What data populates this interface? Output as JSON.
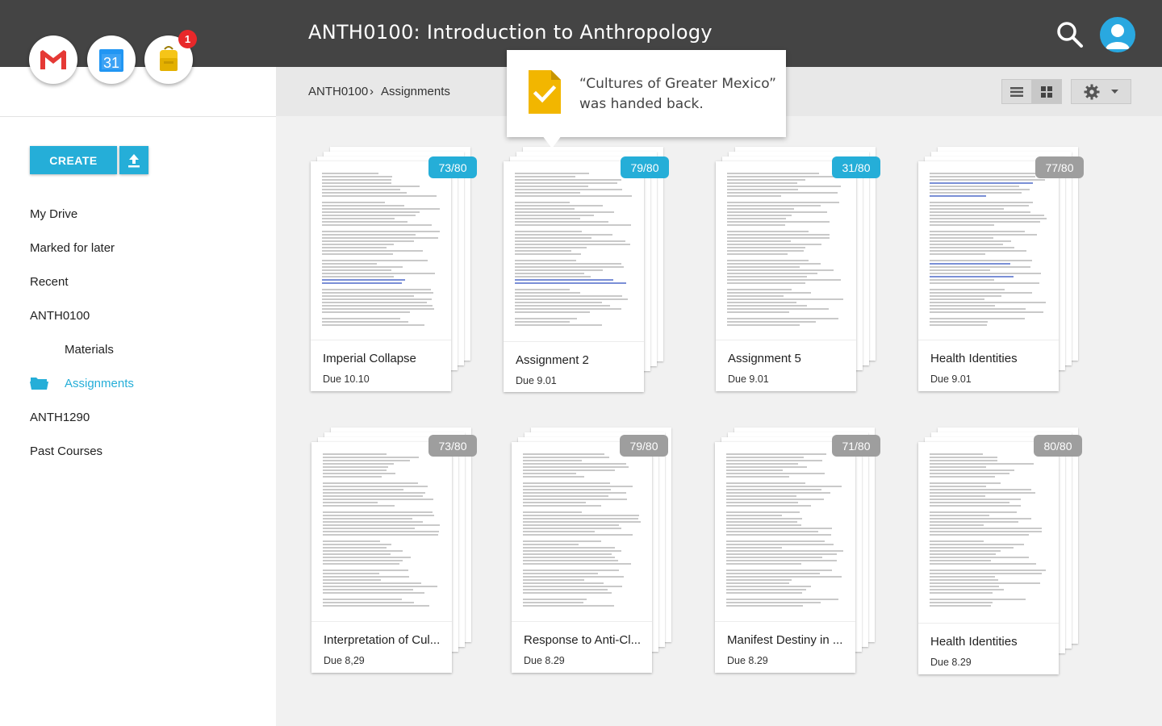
{
  "header": {
    "title": "ANTH0100: Introduction to Anthropology"
  },
  "apps": {
    "notification_count": "1",
    "calendar_day": "31"
  },
  "sidebar": {
    "create_label": "CREATE",
    "items": [
      {
        "label": "My Drive"
      },
      {
        "label": "Marked for later"
      },
      {
        "label": "Recent"
      },
      {
        "label": "ANTH0100"
      },
      {
        "label": "Materials"
      },
      {
        "label": "Assignments"
      },
      {
        "label": "ANTH1290"
      },
      {
        "label": "Past Courses"
      }
    ]
  },
  "breadcrumb": {
    "parent": "ANTH0100",
    "separator": "›",
    "current": "Assignments"
  },
  "tooltip": {
    "line1": "“Cultures of Greater Mexico”",
    "line2": "was handed back."
  },
  "cards": [
    {
      "name": "Imperial Collapse",
      "due": "Due 10.10",
      "grade": "73/80",
      "grade_color": "blue"
    },
    {
      "name": "Assignment 2",
      "due": "Due 9.01",
      "grade": "79/80",
      "grade_color": "blue"
    },
    {
      "name": "Assignment 5",
      "due": "Due 9.01",
      "grade": "31/80",
      "grade_color": "blue"
    },
    {
      "name": "Health Identities",
      "due": "Due 9.01",
      "grade": "77/80",
      "grade_color": "gray"
    },
    {
      "name": "Interpretation of Cul...",
      "due": "Due 8,29",
      "grade": "73/80",
      "grade_color": "gray"
    },
    {
      "name": "Response to Anti-Cl...",
      "due": "Due 8.29",
      "grade": "79/80",
      "grade_color": "gray"
    },
    {
      "name": "Manifest Destiny in ...",
      "due": "Due 8.29",
      "grade": "71/80",
      "grade_color": "gray"
    },
    {
      "name": "Health Identities",
      "due": "Due 8.29",
      "grade": "80/80",
      "grade_color": "gray"
    }
  ],
  "colors": {
    "accent": "#25aed8",
    "topbar": "#444444",
    "graded_gray": "#9e9e9e"
  }
}
